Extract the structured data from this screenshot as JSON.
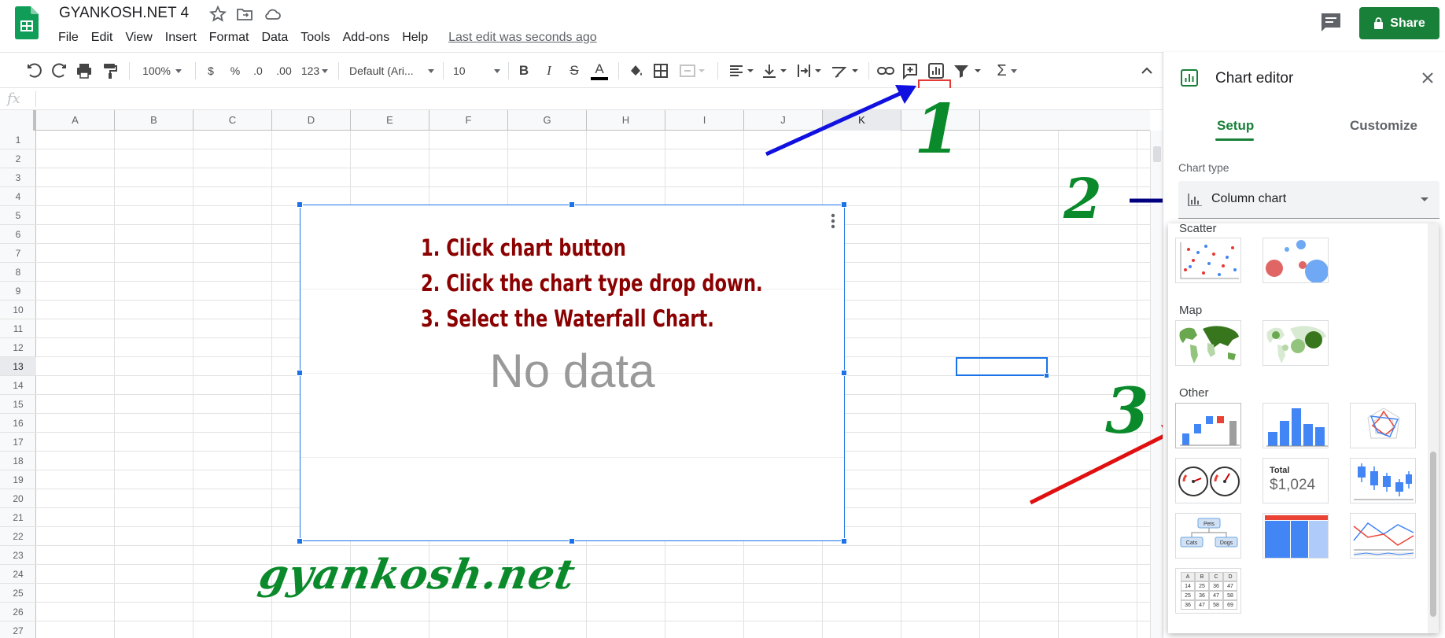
{
  "header": {
    "doc_title": "GYANKOSH.NET 4",
    "menu": [
      "File",
      "Edit",
      "View",
      "Insert",
      "Format",
      "Data",
      "Tools",
      "Add-ons",
      "Help"
    ],
    "last_edit": "Last edit was seconds ago",
    "share_label": "Share"
  },
  "toolbar": {
    "zoom": "100%",
    "currency": "$",
    "percent": "%",
    "decimal_decrease": ".0",
    "decimal_increase": ".00",
    "number_format": "123",
    "font": "Default (Ari...",
    "font_size": "10",
    "bold": "B",
    "italic": "I",
    "strike": "S",
    "text_color": "A",
    "sum": "Σ"
  },
  "formula_bar": {
    "fx": "fx"
  },
  "grid": {
    "columns": [
      "A",
      "B",
      "C",
      "D",
      "E",
      "F",
      "G",
      "H",
      "I",
      "J",
      "K",
      "L"
    ],
    "selected_column": "K",
    "rows": [
      "1",
      "2",
      "3",
      "4",
      "5",
      "6",
      "7",
      "8",
      "9",
      "10",
      "11",
      "12",
      "13",
      "14",
      "15",
      "16",
      "17",
      "18",
      "19",
      "20",
      "21",
      "22",
      "23",
      "24",
      "25",
      "26",
      "27"
    ],
    "selected_row": "13"
  },
  "chart": {
    "instructions": [
      "1. Click chart button",
      "2. Click the chart type drop down.",
      "3. Select the Waterfall Chart."
    ],
    "no_data": "No data"
  },
  "watermark": "gyankosh.net",
  "annotations": {
    "step1": "1",
    "step2": "2",
    "step3": "3"
  },
  "chart_editor": {
    "title": "Chart editor",
    "tabs": [
      "Setup",
      "Customize"
    ],
    "active_tab": "Setup",
    "chart_type_label": "Chart type",
    "chart_type_value": "Column chart",
    "sections": [
      "Scatter",
      "Map",
      "Other"
    ],
    "scorecard_label": "Total",
    "scorecard_value": "$1,024",
    "org_nodes": [
      "Pets",
      "Cats",
      "Dogs"
    ],
    "table_rows": [
      [
        "A",
        "B",
        "C",
        "D"
      ],
      [
        "14",
        "25",
        "36",
        "47"
      ],
      [
        "25",
        "36",
        "47",
        "58"
      ],
      [
        "36",
        "47",
        "58",
        "69"
      ]
    ]
  },
  "colors": {
    "accent_green": "#188038",
    "selection_blue": "#1a73e8",
    "instruction_red": "#8b0000",
    "annotation_green": "#0a8a2a"
  }
}
